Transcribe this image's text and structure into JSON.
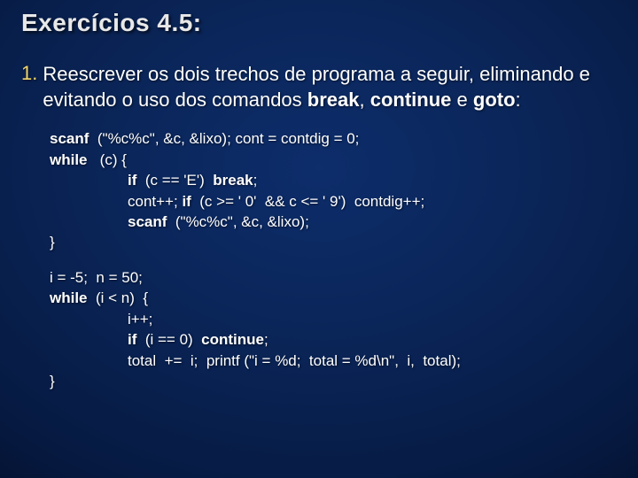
{
  "title": "Exercícios 4.5:",
  "item_number": "1.",
  "body1": "Reescrever os dois trechos de programa a seguir, eliminando e evitando o uso dos comandos ",
  "b_break": "break",
  "b_sep1": ", ",
  "b_cont": "continue",
  "b_sep2": " e ",
  "b_goto": "goto",
  "body_end": ":",
  "c1": {
    "l1a": "scanf",
    "l1b": "  (\"%c%c\", &c, &lixo); cont = contdig = 0;",
    "l2a": "while",
    "l2b": "   (c) {",
    "l3a": "if",
    "l3b": "  (c == 'E')  ",
    "l3c": "break",
    "l3d": ";",
    "l4a": "cont++; ",
    "l4b": "if",
    "l4c": "  (c >= ' 0'  && c <= ' 9')  contdig++;",
    "l5a": "scanf",
    "l5b": "  (\"%c%c\", &c, &lixo);",
    "l6": "}"
  },
  "c2": {
    "l1": "i = -5;  n = 50;",
    "l2a": "while",
    "l2b": "  (i < n)  {",
    "l3": "i++;",
    "l4a": "if",
    "l4b": "  (i == 0)  ",
    "l4c": "continue",
    "l4d": ";",
    "l5": "total  +=  i;  printf (\"i = %d;  total = %d\\n\",  i,  total);",
    "l6": "}"
  }
}
